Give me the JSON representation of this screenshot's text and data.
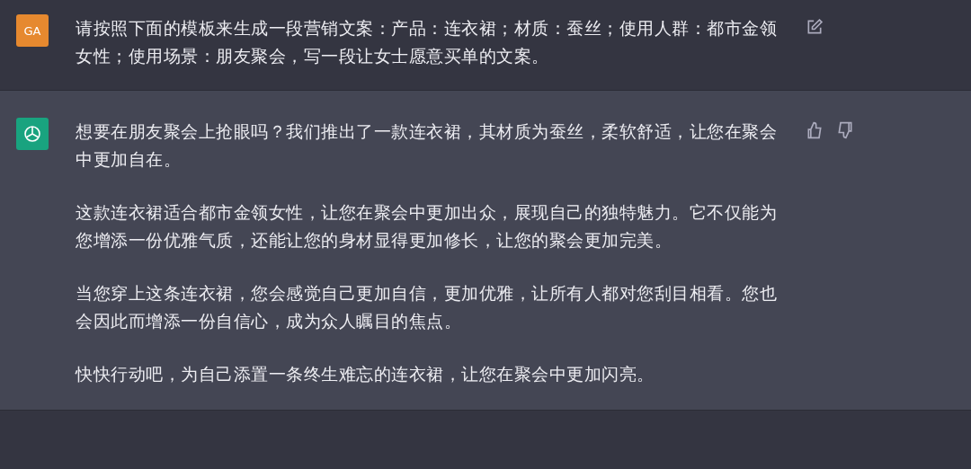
{
  "messages": [
    {
      "kind": "user",
      "avatar": "GA",
      "paragraphs": [
        "请按照下面的模板来生成一段营销文案：产品：连衣裙；材质：蚕丝；使用人群：都市金领女性；使用场景：朋友聚会，写一段让女士愿意买单的文案。"
      ]
    },
    {
      "kind": "assistant",
      "paragraphs": [
        "想要在朋友聚会上抢眼吗？我们推出了一款连衣裙，其材质为蚕丝，柔软舒适，让您在聚会中更加自在。",
        "这款连衣裙适合都市金领女性，让您在聚会中更加出众，展现自己的独特魅力。它不仅能为您增添一份优雅气质，还能让您的身材显得更加修长，让您的聚会更加完美。",
        "当您穿上这条连衣裙，您会感觉自己更加自信，更加优雅，让所有人都对您刮目相看。您也会因此而增添一份自信心，成为众人瞩目的焦点。",
        "快快行动吧，为自己添置一条终生难忘的连衣裙，让您在聚会中更加闪亮。"
      ]
    }
  ]
}
